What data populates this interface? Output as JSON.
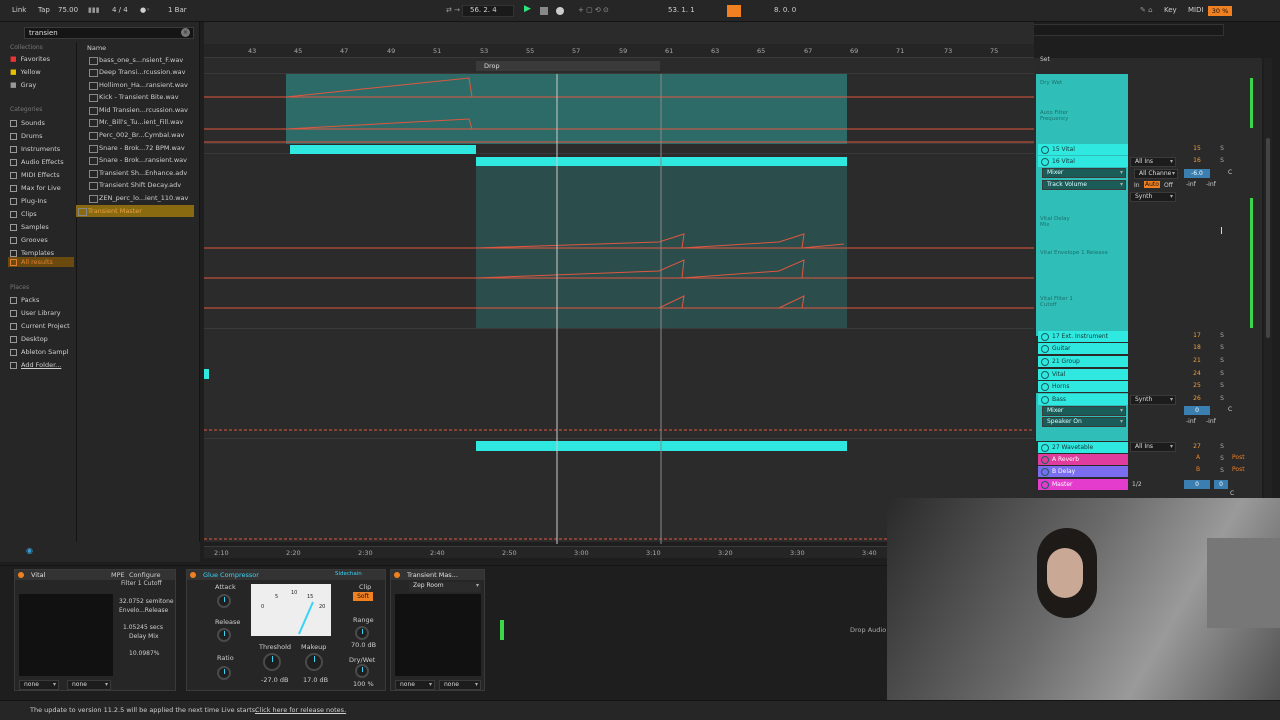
{
  "topbar": {
    "link": "Link",
    "tap": "Tap",
    "tempo": "75.00",
    "signature": "4 / 4",
    "quantize": "1 Bar",
    "position": "56. 2. 4",
    "loop_start": "53. 1. 1",
    "loop_length": "8. 0. 0",
    "key": "Key",
    "midi": "MIDI",
    "cpu": "30 %"
  },
  "browser": {
    "search_value": "transien",
    "collections_heading": "Collections",
    "collections": [
      "Favorites",
      "Yellow",
      "Gray"
    ],
    "categories_heading": "Categories",
    "categories": [
      "Sounds",
      "Drums",
      "Instruments",
      "Audio Effects",
      "MIDI Effects",
      "Max for Live",
      "Plug-Ins",
      "Clips",
      "Samples",
      "Grooves",
      "Templates",
      "All results"
    ],
    "places_heading": "Places",
    "places": [
      "Packs",
      "User Library",
      "Current Project",
      "Desktop",
      "Ableton Sampl",
      "Add Folder..."
    ],
    "column_name": "Name",
    "files": [
      "bass_one_s...nsient_F.wav",
      "Deep Transi...rcussion.wav",
      "Hollimon_Ha...ransient.wav",
      "Kick - Transient Bite.wav",
      "Mid Transien...rcussion.wav",
      "Mr._Bill's_Tu...ient_Fill.wav",
      "Perc_002_Br...Cymbal.wav",
      "Snare - Brok...72 BPM.wav",
      "Snare - Brok...ransient.wav",
      "Transient Sh...Enhance.adv",
      "Transient Shift Decay.adv",
      "ZEN_perc_lo...ient_110.wav",
      "Transient Master"
    ]
  },
  "arrangement": {
    "ruler": [
      "43",
      "45",
      "47",
      "49",
      "51",
      "53",
      "55",
      "57",
      "59",
      "61",
      "63",
      "65",
      "67",
      "69",
      "71",
      "73",
      "75"
    ],
    "locator": "Drop",
    "time_ruler": [
      "2:10",
      "2:20",
      "2:30",
      "2:40",
      "2:50",
      "3:00",
      "3:10",
      "3:20",
      "3:30",
      "3:40"
    ]
  },
  "mixer": {
    "set_label": "Set",
    "auto_labels": [
      "Dry Wet",
      "Auto Filter Frequency",
      "Vital Delay Mix",
      "Vital Envelope 1 Release",
      "Vital Filter 1 Cutoff"
    ],
    "tracks": [
      {
        "name": "15 Vital",
        "num": "15"
      },
      {
        "name": "16 Vital",
        "num": "16"
      },
      {
        "name": "17 Ext. Instrument",
        "num": "17"
      },
      {
        "name": "Guitar",
        "num": "18"
      },
      {
        "name": "21 Group",
        "num": "21"
      },
      {
        "name": "Vital",
        "num": "24"
      },
      {
        "name": "Horns",
        "num": "25"
      },
      {
        "name": "Bass",
        "num": "26"
      },
      {
        "name": "27 Wavetable",
        "num": "27"
      }
    ],
    "returns": [
      {
        "name": "A Reverb",
        "letter": "A",
        "post": "Post"
      },
      {
        "name": "B Delay",
        "letter": "B",
        "post": "Post"
      }
    ],
    "master": "Master",
    "master_fraction": "1/2",
    "track16": {
      "input": "All Ins",
      "channel": "All Channe",
      "mixer": "Mixer",
      "param": "Track Volume",
      "in_auto": "In",
      "auto": "Auto",
      "off": "Off",
      "synth": "Synth",
      "vol": "-6.0",
      "inf1": "-inf",
      "inf2": "-inf",
      "pan": "C"
    },
    "bass": {
      "mixer": "Mixer",
      "speaker": "Speaker On",
      "synth": "Synth",
      "vol": "0",
      "inf1": "-inf",
      "inf2": "-inf",
      "pan": "C"
    },
    "wavetable_input": "All Ins",
    "master_vals": {
      "a": "0",
      "b": "0",
      "c": "C"
    },
    "s_label": "S"
  },
  "devices": {
    "vital": {
      "title": "Vital",
      "mpe": "MPE",
      "configure": "Configure",
      "params": [
        {
          "name": "Filter 1 Cutoff",
          "value": "32.0752 semitone"
        },
        {
          "name": "Envelo...Release",
          "value": "1.05245 secs"
        },
        {
          "name": "Delay Mix",
          "value": "10.0987%"
        }
      ],
      "none1": "none",
      "none2": "none"
    },
    "glue": {
      "title": "Glue Compressor",
      "sidechain": "Sidechain",
      "attack": "Attack",
      "release": "Release",
      "ratio": "Ratio",
      "threshold": "Threshold",
      "threshold_val": "-27.0 dB",
      "makeup": "Makeup",
      "makeup_val": "17.0 dB",
      "clip": "Clip",
      "soft": "Soft",
      "range": "Range",
      "range_val": "70.0 dB",
      "drywet": "Dry/Wet",
      "drywet_val": "100 %",
      "meter_ticks": [
        "0",
        "5",
        "10",
        "15",
        "20"
      ]
    },
    "transient": {
      "title": "Transient Mas...",
      "preset": "Zep Room",
      "none1": "none",
      "none2": "none"
    },
    "drop_hint": "Drop Audio"
  },
  "status": {
    "message": "The update to version 11.2.5 will be applied the next time Live starts.",
    "link": "Click here for release notes."
  },
  "colors": {
    "accent": "#2fe8df",
    "orange": "#f08020",
    "automation": "#e0573f",
    "return": "#e03c9e",
    "master": "#e43ccd"
  }
}
